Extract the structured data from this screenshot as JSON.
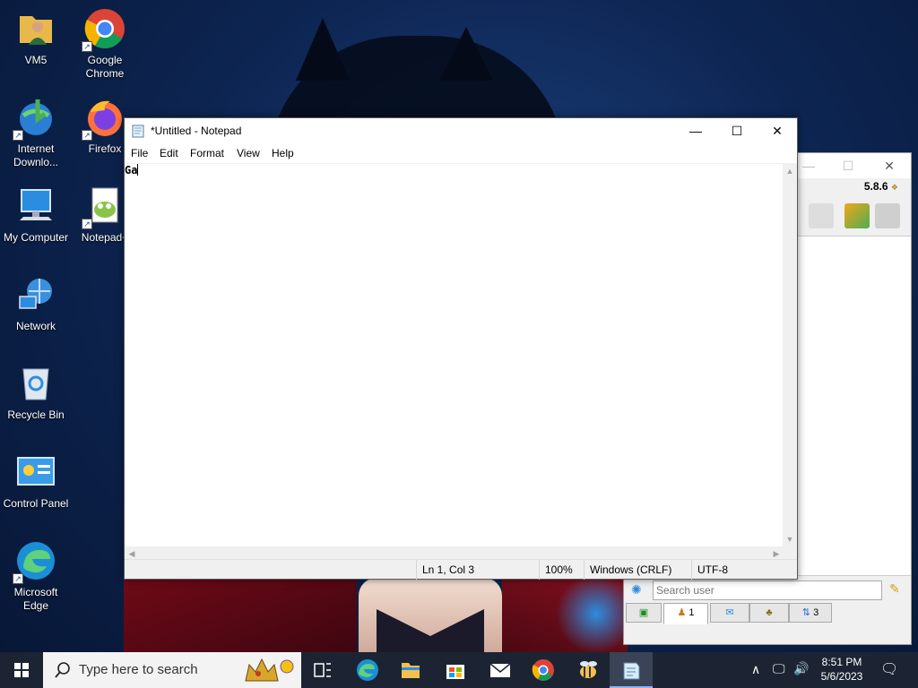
{
  "desktop": {
    "icons": [
      {
        "label": "VM5",
        "icon": "user-folder-icon"
      },
      {
        "label": "Google Chrome",
        "icon": "chrome-icon"
      },
      {
        "label": "Internet Downlo...",
        "icon": "internet-download-manager-icon"
      },
      {
        "label": "Firefox",
        "icon": "firefox-icon"
      },
      {
        "label": "My Computer",
        "icon": "computer-icon"
      },
      {
        "label": "Notepad+",
        "icon": "notepad-plus-icon"
      },
      {
        "label": "Network",
        "icon": "network-icon"
      },
      {
        "label": "Recycle Bin",
        "icon": "recycle-bin-icon"
      },
      {
        "label": "Control Panel",
        "icon": "control-panel-icon"
      },
      {
        "label": "Microsoft Edge",
        "icon": "edge-icon"
      }
    ]
  },
  "notepad": {
    "title": "*Untitled - Notepad",
    "menu": [
      "File",
      "Edit",
      "Format",
      "View",
      "Help"
    ],
    "content": "Ga",
    "status": {
      "position": "Ln 1, Col 3",
      "zoom": "100%",
      "line_ending": "Windows (CRLF)",
      "encoding": "UTF-8"
    }
  },
  "background_app": {
    "version": "5.8.6",
    "search_placeholder": "Search user",
    "tabs": [
      {
        "icon": "green-screen-icon",
        "count": ""
      },
      {
        "icon": "users-icon",
        "count": "1"
      },
      {
        "icon": "chat-icon",
        "count": ""
      },
      {
        "icon": "group-icon",
        "count": ""
      },
      {
        "icon": "transfer-icon",
        "count": "3"
      }
    ]
  },
  "taskbar": {
    "search_placeholder": "Type here to search",
    "apps": [
      "task-view-icon",
      "edge-icon",
      "file-explorer-icon",
      "store-icon",
      "mail-icon",
      "chrome-icon",
      "bee-app-icon",
      "notepad-icon"
    ],
    "clock_time": "8:51 PM",
    "clock_date": "5/6/2023"
  },
  "colors": {
    "taskbar": "#1c2433",
    "desktop_bg": "#0d2552",
    "window_bg": "#ffffff"
  }
}
